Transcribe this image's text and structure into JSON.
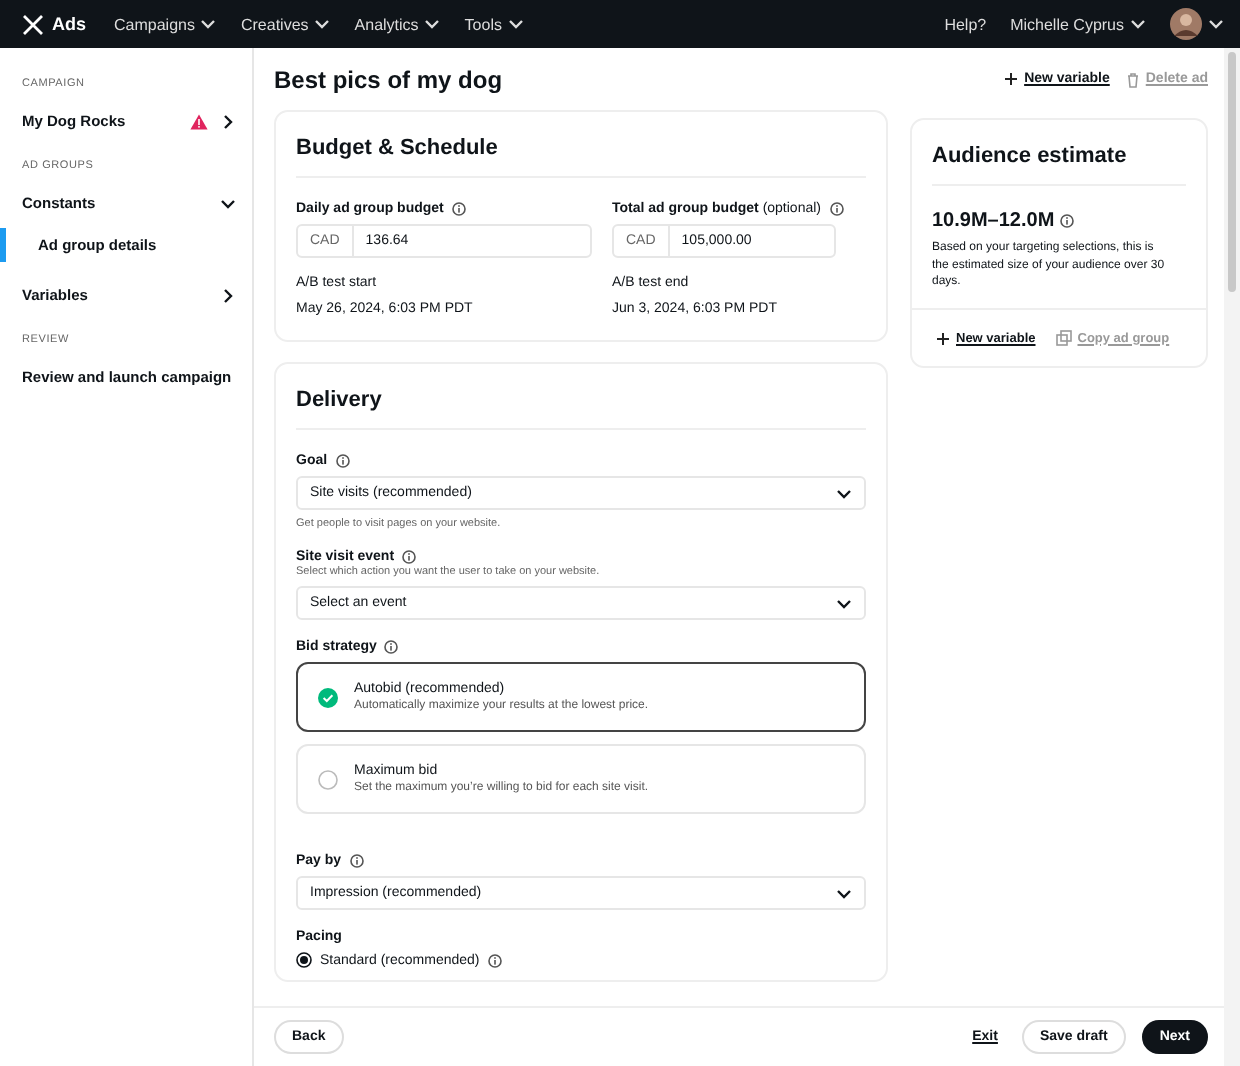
{
  "topbar": {
    "logo": "Ads",
    "nav": [
      {
        "label": "Campaigns"
      },
      {
        "label": "Creatives"
      },
      {
        "label": "Analytics"
      },
      {
        "label": "Tools"
      }
    ],
    "help": "Help?",
    "user": "Michelle Cyprus"
  },
  "sidebar": {
    "sections": [
      {
        "heading": "CAMPAIGN",
        "items": [
          {
            "label": "My Dog Rocks",
            "kind": "group",
            "warning": true,
            "expanded": false
          }
        ]
      },
      {
        "heading": "AD GROUPS",
        "items": [
          {
            "label": "Constants",
            "kind": "group",
            "warning": false,
            "expanded": true,
            "children": [
              {
                "label": "Ad group details",
                "selected": true
              }
            ]
          },
          {
            "label": "Variables",
            "kind": "group",
            "warning": false,
            "expanded": false
          }
        ]
      },
      {
        "heading": "REVIEW",
        "items": [
          {
            "label": "Review and launch campaign",
            "kind": "link"
          }
        ]
      }
    ]
  },
  "header": {
    "title": "Best pics of my dog",
    "actions": [
      {
        "label": "New variable",
        "kind": "plus",
        "disabled": false
      },
      {
        "label": "Delete ad",
        "kind": "trash",
        "disabled": true
      }
    ]
  },
  "budget": {
    "title": "Budget & Schedule",
    "fields": [
      {
        "label": "Daily ad group budget",
        "currency": "CAD",
        "value": "136.64"
      },
      {
        "label": "Total ad group budget",
        "optional": "(optional)",
        "currency": "CAD",
        "value": "105,000.00"
      }
    ],
    "dates": [
      {
        "label": "A/B test start",
        "value": "May 26, 2024, 6:03 PM PDT"
      },
      {
        "label": "A/B test end",
        "value": "Jun 3, 2024, 6:03 PM PDT"
      }
    ]
  },
  "audience": {
    "title": "Audience estimate",
    "range": "10.9M–12.0M",
    "description": "Based on your targeting selections, this is the estimated size of your audience over 30 days.",
    "actions": [
      {
        "label": "New variable",
        "kind": "plus",
        "disabled": false
      },
      {
        "label": "Copy ad group",
        "kind": "copy",
        "disabled": true
      }
    ]
  },
  "delivery": {
    "title": "Delivery",
    "goal": {
      "label": "Goal",
      "value": "Site visits (recommended)",
      "help": "Get people to visit pages on your website."
    },
    "site_event": {
      "label": "Site visit event",
      "description": "Select which action you want the user to take on your website.",
      "placeholder": "Select an event"
    },
    "bid_strategy": {
      "label": "Bid strategy",
      "options": [
        {
          "title": "Autobid (recommended)",
          "description": "Automatically maximize your results at the lowest price.",
          "selected": true
        },
        {
          "title": "Maximum bid",
          "description": "Set the maximum you’re willing to bid for each site visit.",
          "selected": false
        }
      ]
    },
    "pay_by": {
      "label": "Pay by",
      "value": "Impression (recommended)"
    },
    "pacing": {
      "label": "Pacing",
      "options": [
        {
          "label": "Standard (recommended)",
          "selected": true
        }
      ]
    }
  },
  "footer": {
    "back": "Back",
    "exit": "Exit",
    "save": "Save draft",
    "next": "Next"
  }
}
